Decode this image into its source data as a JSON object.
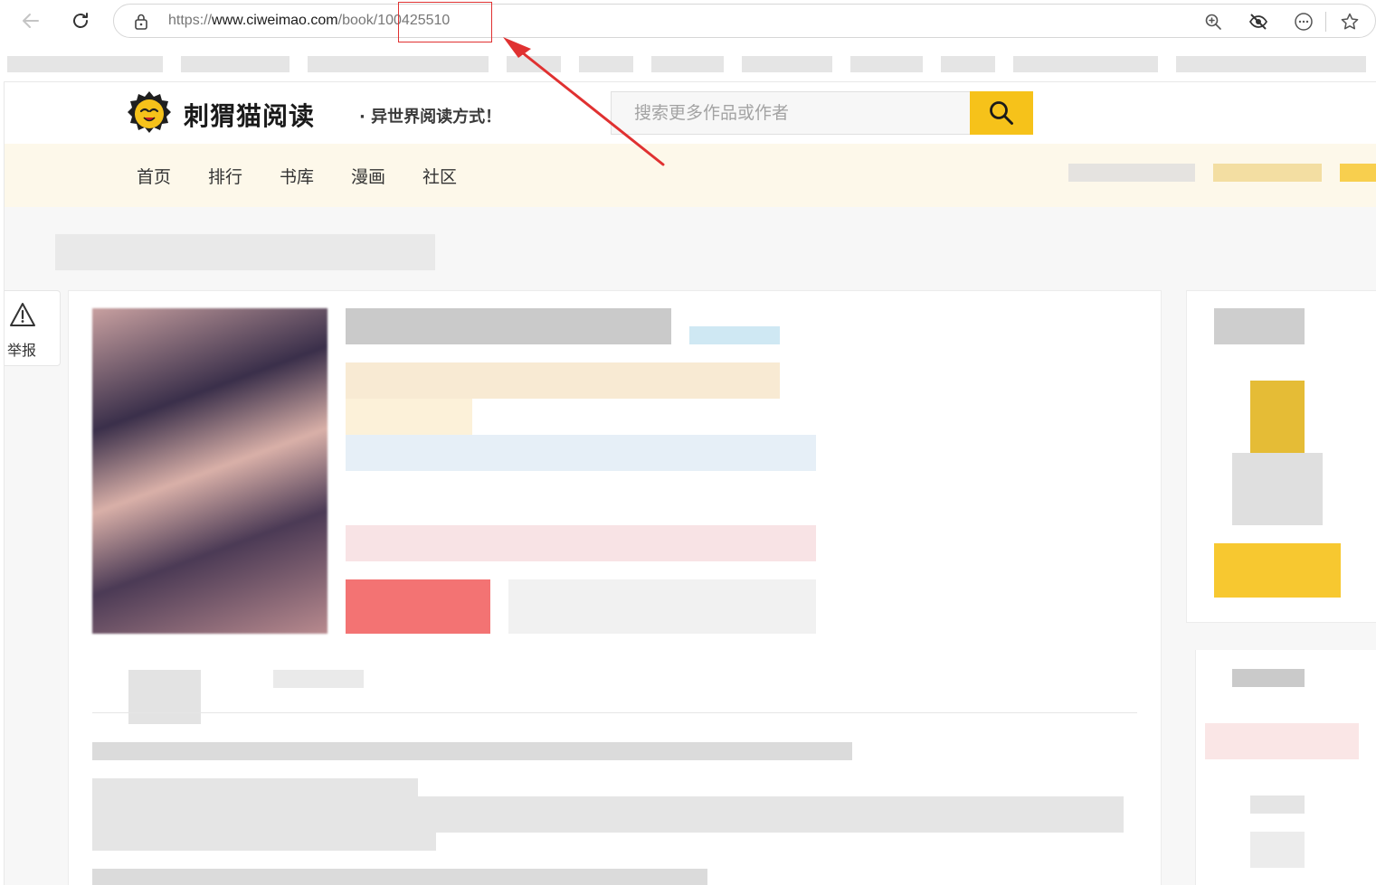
{
  "browser": {
    "url_prefix": "https://",
    "url_host": "www.ciweimao.com",
    "url_path": "/book/",
    "url_id": "100425510"
  },
  "site": {
    "brand": "刺猬猫阅读",
    "tagline": "· 异世界阅读方式！",
    "search_placeholder": "搜索更多作品或作者",
    "nav": [
      "首页",
      "排行",
      "书库",
      "漫画",
      "社区"
    ]
  },
  "report": {
    "label": "举报"
  },
  "colors": {
    "accent": "#f6c21a",
    "nav_bg": "#fdf8ea",
    "annotation": "#e03131"
  },
  "icons": {
    "back": "arrow-left-icon",
    "reload": "reload-icon",
    "lock": "lock-icon",
    "zoom": "zoom-in-icon",
    "tracking": "eye-off-icon",
    "more": "more-icon",
    "favorite": "star-icon",
    "search": "search-icon",
    "report": "warning-triangle-icon"
  }
}
